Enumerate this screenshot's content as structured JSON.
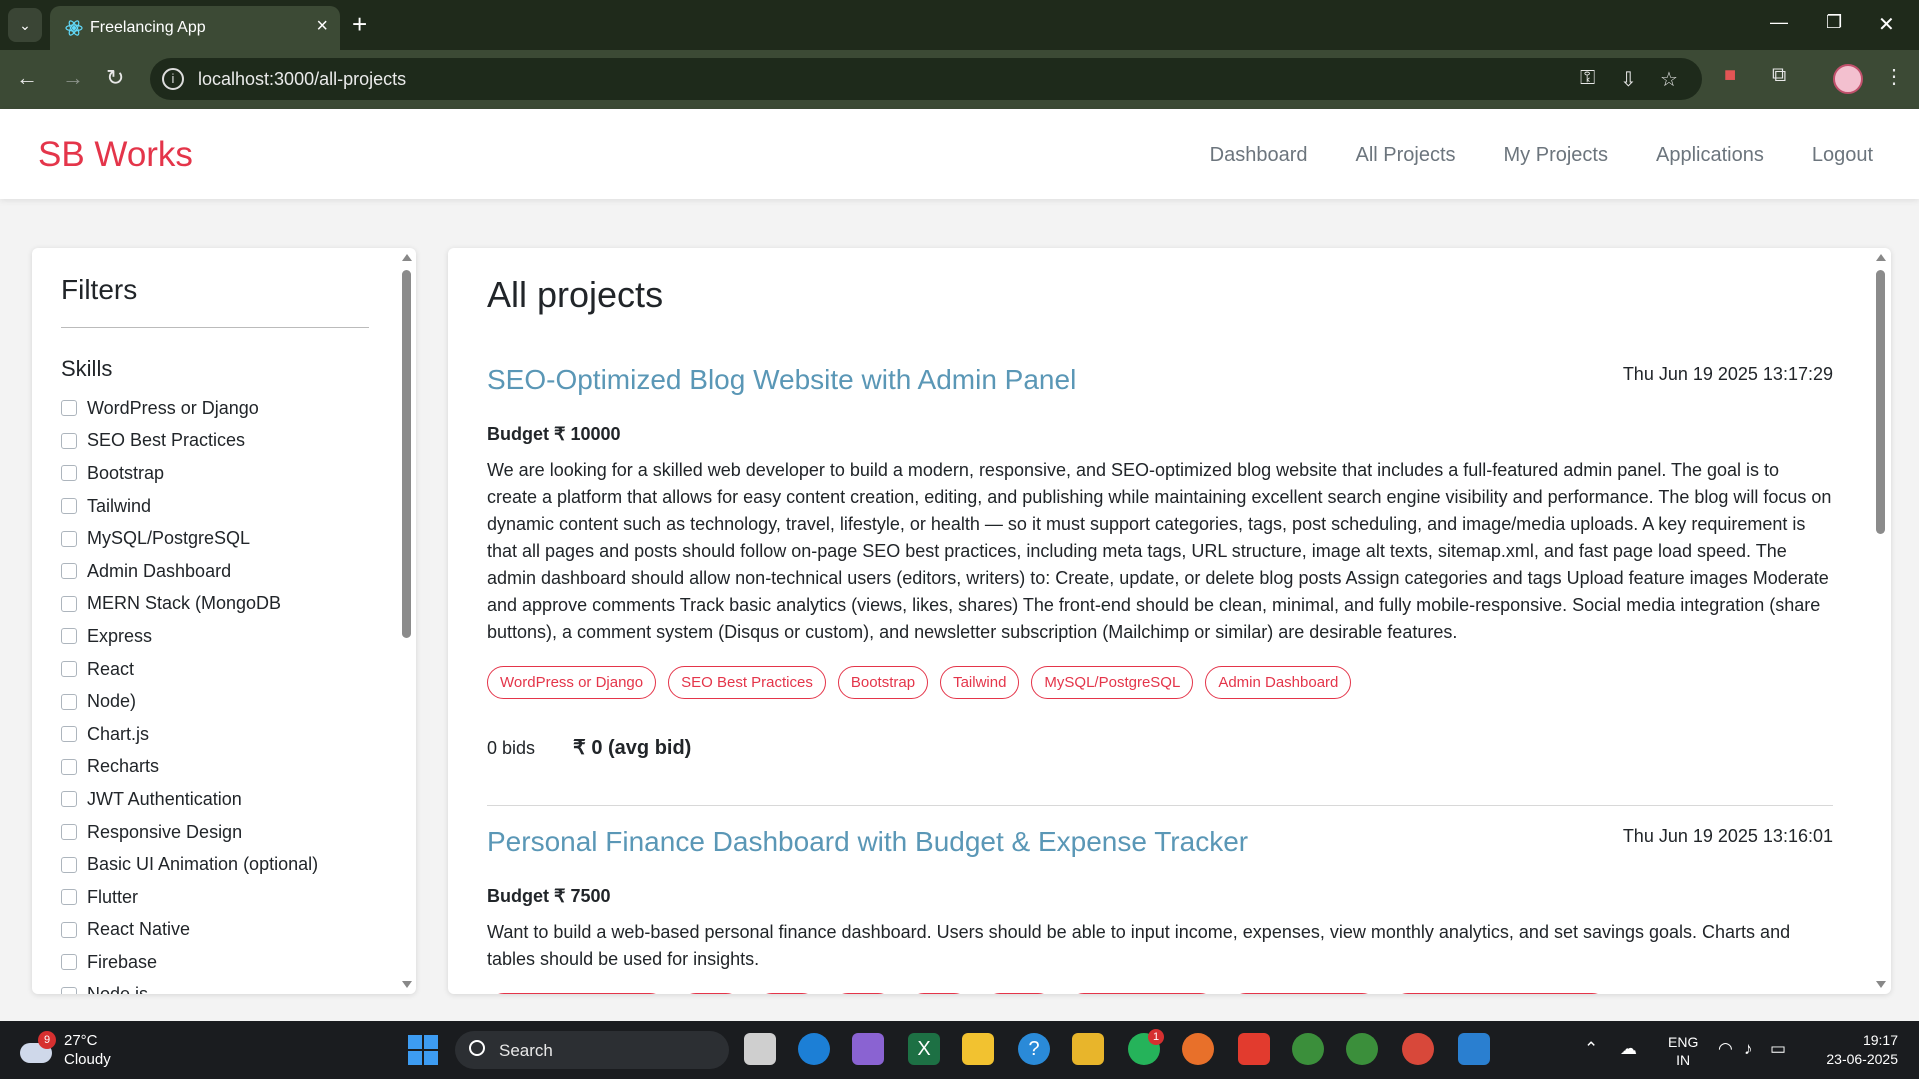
{
  "browser": {
    "tab_title": "Freelancing App",
    "url": "localhost:3000/all-projects"
  },
  "app": {
    "brand": "SB Works",
    "brand_color": "#e4354a",
    "nav": [
      "Dashboard",
      "All Projects",
      "My Projects",
      "Applications",
      "Logout"
    ]
  },
  "filters": {
    "title": "Filters",
    "skills_heading": "Skills",
    "skills": [
      "WordPress or Django",
      "SEO Best Practices",
      "Bootstrap",
      "Tailwind",
      "MySQL/PostgreSQL",
      "Admin Dashboard",
      "MERN Stack (MongoDB",
      "Express",
      "React",
      "Node)",
      "Chart.js",
      "Recharts",
      "JWT Authentication",
      "Responsive Design",
      "Basic UI Animation (optional)",
      "Flutter",
      "React Native",
      "Firebase",
      "Node.js"
    ]
  },
  "projects": {
    "heading": "All projects",
    "title_color": "#5a97b6",
    "items": [
      {
        "title": "SEO-Optimized Blog Website with Admin Panel",
        "date": "Thu Jun 19 2025 13:17:29",
        "budget": "Budget ₹ 10000",
        "description": "We are looking for a skilled web developer to build a modern, responsive, and SEO-optimized blog website that includes a full-featured admin panel. The goal is to create a platform that allows for easy content creation, editing, and publishing while maintaining excellent search engine visibility and performance. The blog will focus on dynamic content such as technology, travel, lifestyle, or health — so it must support categories, tags, post scheduling, and image/media uploads. A key requirement is that all pages and posts should follow on-page SEO best practices, including meta tags, URL structure, image alt texts, sitemap.xml, and fast page load speed. The admin dashboard should allow non-technical users (editors, writers) to: Create, update, or delete blog posts Assign categories and tags Upload feature images Moderate and approve comments Track basic analytics (views, likes, shares) The front-end should be clean, minimal, and fully mobile-responsive. Social media integration (share buttons), a comment system (Disqus or custom), and newsletter subscription (Mailchimp or similar) are desirable features.",
        "tags": [
          "WordPress or Django",
          "SEO Best Practices",
          "Bootstrap",
          "Tailwind",
          "MySQL/PostgreSQL",
          "Admin Dashboard"
        ],
        "bids": "0 bids",
        "avg_bid": "₹ 0 (avg bid)"
      },
      {
        "title": "Personal Finance Dashboard with Budget & Expense Tracker",
        "date": "Thu Jun 19 2025 13:16:01",
        "budget": "Budget ₹ 7500",
        "description": "Want to build a web-based personal finance dashboard. Users should be able to input income, expenses, view monthly analytics, and set savings goals. Charts and tables should be used for insights."
      }
    ]
  },
  "taskbar": {
    "weather_temp": "27°C",
    "weather_desc": "Cloudy",
    "weather_badge": "9",
    "search_label": "Search",
    "whatsapp_badge": "1",
    "lang_top": "ENG",
    "lang_bottom": "IN",
    "time": "19:17",
    "date": "23-06-2025"
  }
}
